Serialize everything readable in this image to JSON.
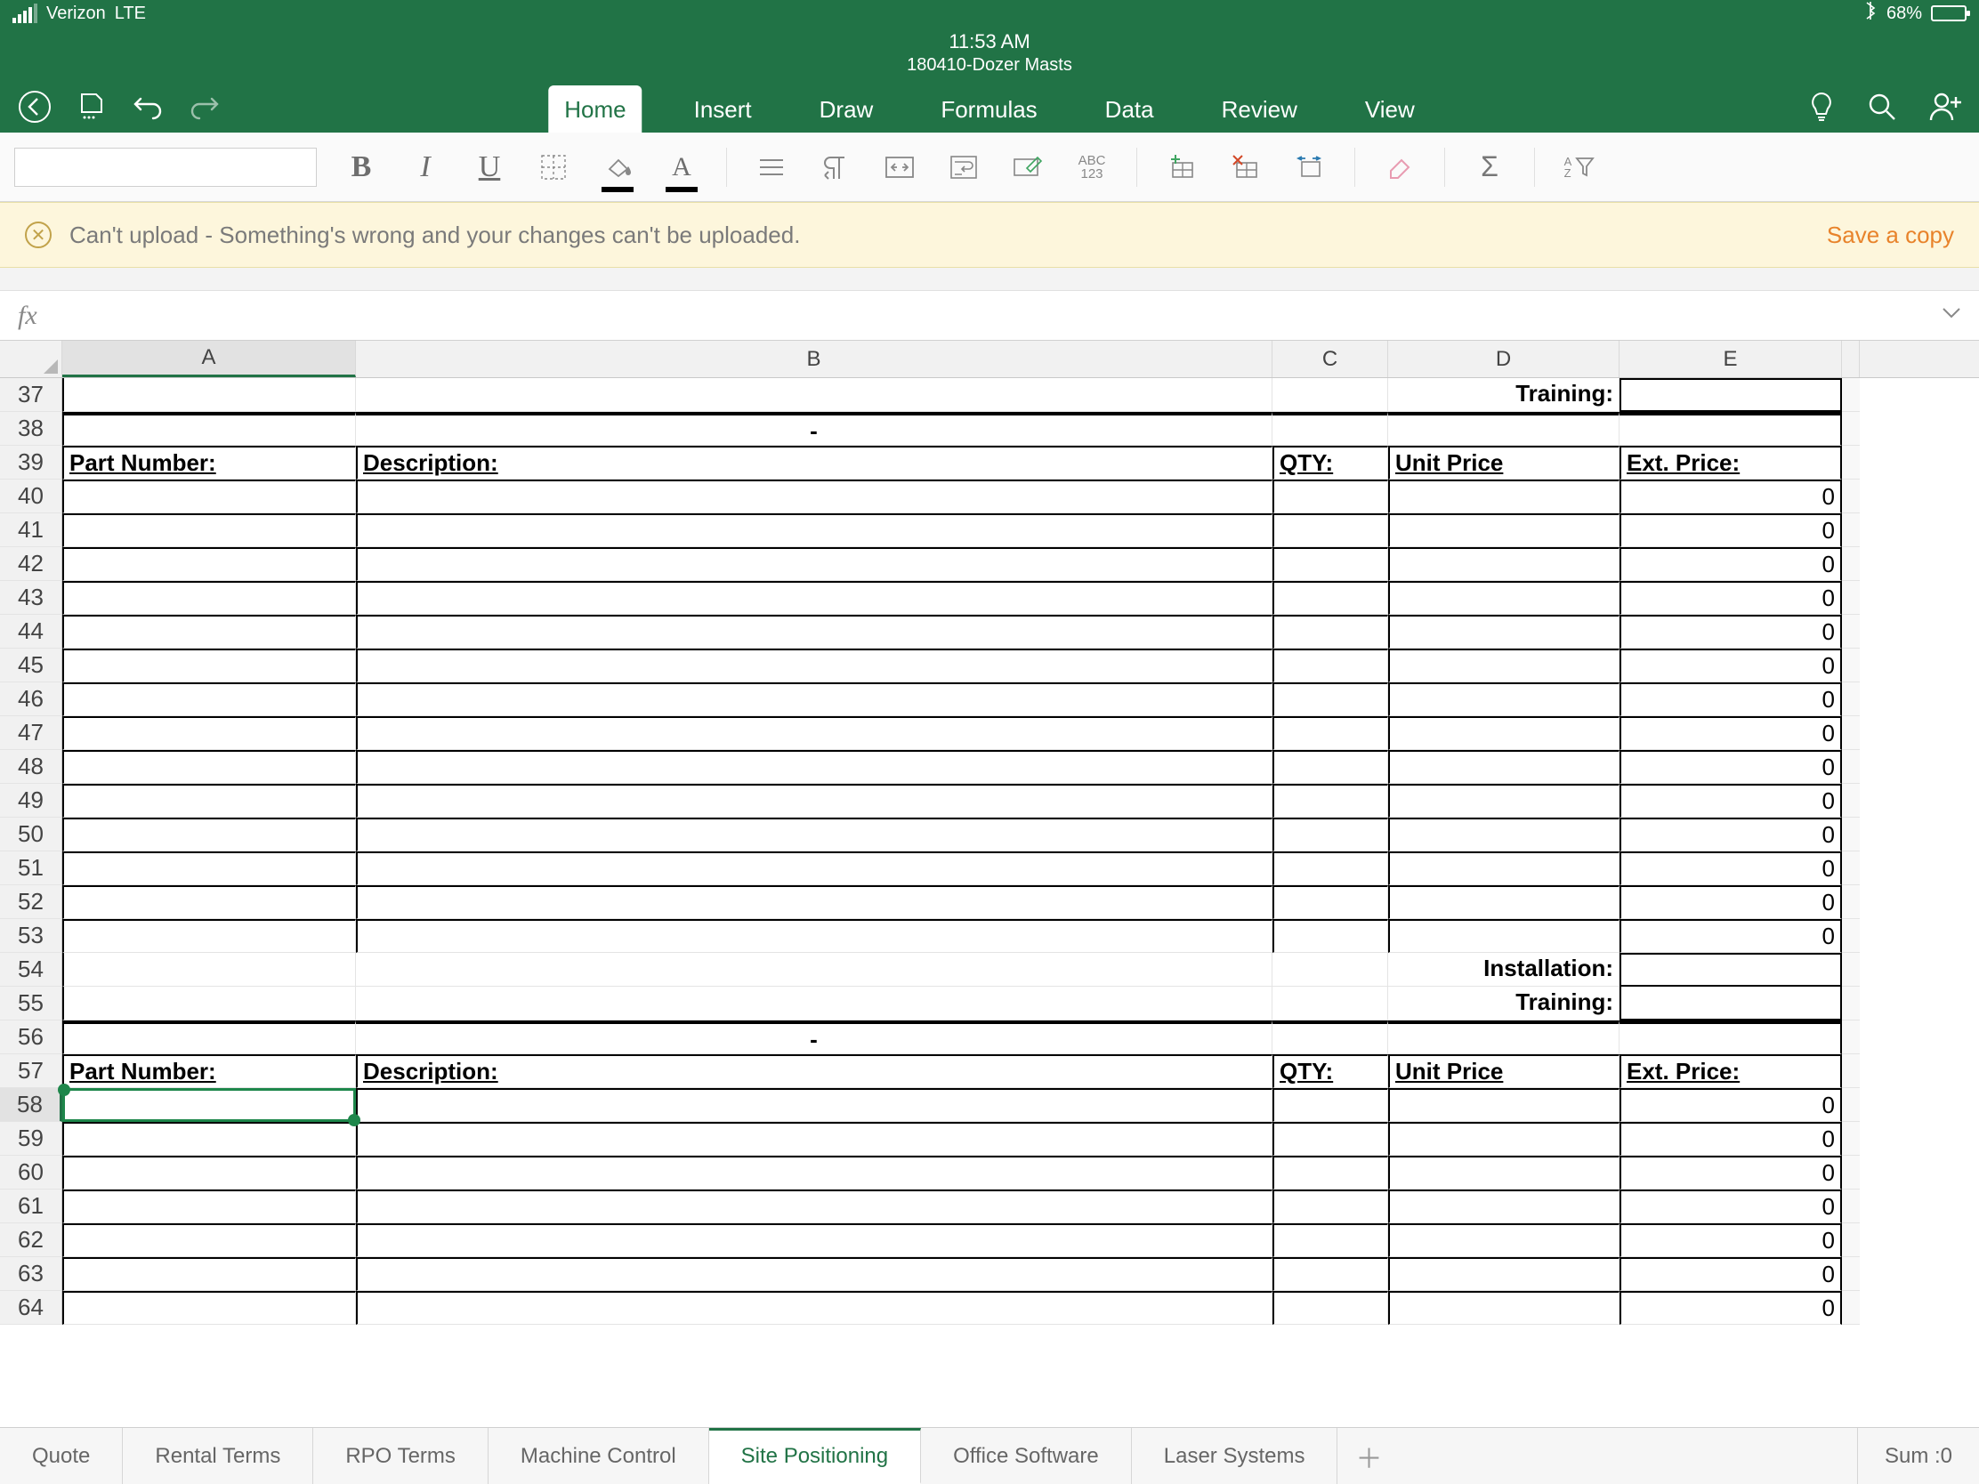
{
  "status": {
    "carrier": "Verizon",
    "network": "LTE",
    "time": "11:53 AM",
    "battery_pct": "68%"
  },
  "doc": {
    "title": "180410-Dozer Masts"
  },
  "ribbon_tabs": [
    "Home",
    "Insert",
    "Draw",
    "Formulas",
    "Data",
    "Review",
    "View"
  ],
  "toolbar": {
    "abc123": "ABC\n123",
    "sigma": "Σ",
    "az": "A\nZ"
  },
  "warning": {
    "msg": "Can't upload - Something's wrong and your changes can't be uploaded.",
    "action": "Save a copy"
  },
  "formula": {
    "fx": "fx"
  },
  "columns": [
    "A",
    "B",
    "C",
    "D",
    "E"
  ],
  "row_headers": [
    "37",
    "38",
    "39",
    "40",
    "41",
    "42",
    "43",
    "44",
    "45",
    "46",
    "47",
    "48",
    "49",
    "50",
    "51",
    "52",
    "53",
    "54",
    "55",
    "56",
    "57",
    "58",
    "59",
    "60",
    "61",
    "62",
    "63",
    "64"
  ],
  "cells": {
    "training": "Training:",
    "installation": "Installation:",
    "dash": "-",
    "part_number": "Part Number:",
    "description": "Description:",
    "qty": "QTY:",
    "unit_price": "Unit Price",
    "ext_price": "Ext. Price:",
    "zero": "0"
  },
  "sheet_tabs": [
    "Quote",
    "Rental Terms",
    "RPO Terms",
    "Machine Control",
    "Site Positioning",
    "Office Software",
    "Laser Systems"
  ],
  "sheet_active": 4,
  "sum_label": "Sum :0"
}
